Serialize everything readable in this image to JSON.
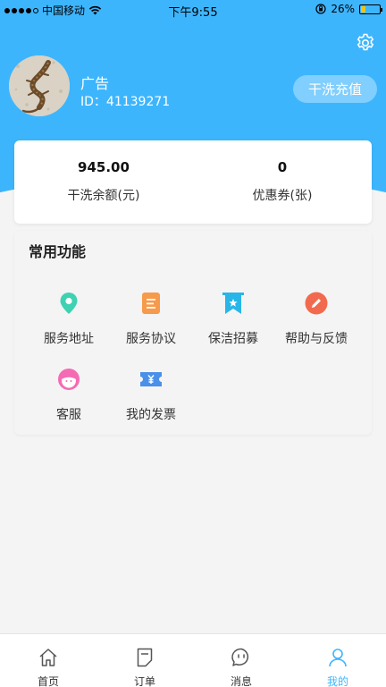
{
  "status_bar": {
    "carrier": "中国移动",
    "time": "下午9:55",
    "battery": "26%",
    "battery_level": 0.26
  },
  "profile": {
    "name": "广告",
    "id_text": "ID：41139271",
    "recharge_label": "干洗充值"
  },
  "balance": {
    "amount": "945.00",
    "amount_label": "干洗余额(元)",
    "coupons": "0",
    "coupons_label": "优惠券(张)"
  },
  "functions": {
    "title": "常用功能",
    "items": [
      {
        "label": "服务地址",
        "icon": "location-icon"
      },
      {
        "label": "服务协议",
        "icon": "document-icon"
      },
      {
        "label": "保洁招募",
        "icon": "bookmark-star-icon"
      },
      {
        "label": "帮助与反馈",
        "icon": "pencil-icon"
      },
      {
        "label": "客服",
        "icon": "customer-service-icon"
      },
      {
        "label": "我的发票",
        "icon": "invoice-ticket-icon"
      }
    ]
  },
  "tabs": [
    {
      "label": "首页",
      "icon": "home-icon"
    },
    {
      "label": "订单",
      "icon": "order-icon"
    },
    {
      "label": "消息",
      "icon": "message-icon"
    },
    {
      "label": "我的",
      "icon": "user-icon",
      "active": true
    }
  ],
  "colors": {
    "primary": "#3db5fd",
    "location": "#3fd2b2",
    "document": "#f79a4b",
    "bookmark": "#28b6e8",
    "pencil": "#f26a4e",
    "service": "#f46bb3",
    "invoice": "#4a90e8"
  }
}
